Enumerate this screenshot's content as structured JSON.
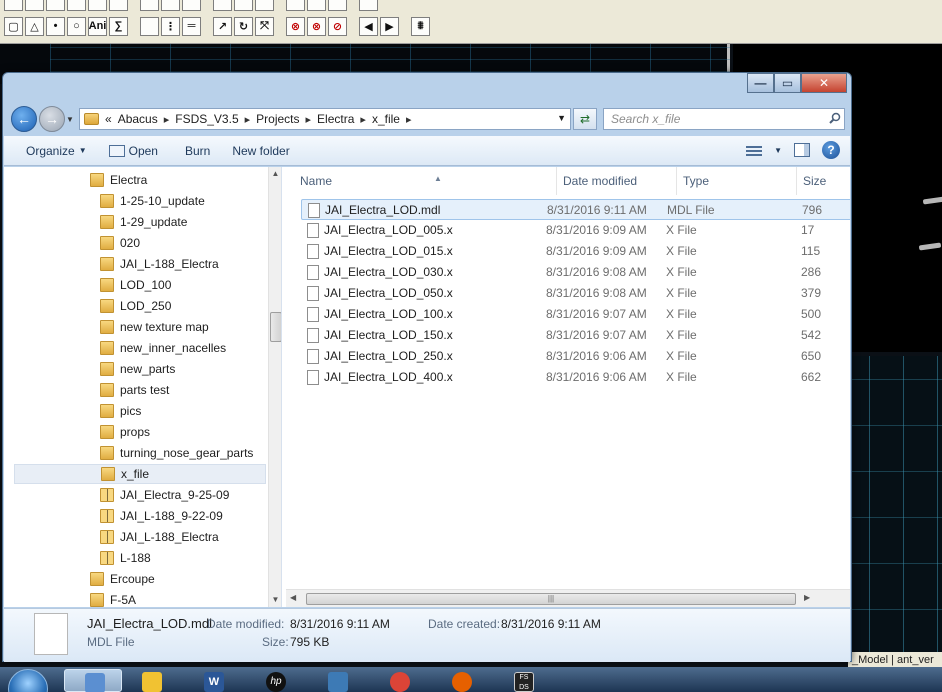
{
  "background_app": {
    "toolbar_top_row": [
      "",
      "",
      "",
      "",
      "",
      "",
      "",
      "",
      "",
      "",
      "",
      "",
      "",
      "",
      "",
      ""
    ],
    "toolbar_bottom_row": [
      "▢",
      "△",
      "•",
      "○",
      "Ani",
      "∑",
      "",
      "⋮",
      "═",
      "↗",
      "↻",
      "⤧",
      "⊗",
      "⊗",
      "⊘",
      "◀",
      "▶",
      "⩩"
    ],
    "model_tab_label": "_Model | ant_ver"
  },
  "window": {
    "controls": {
      "minimize": "—",
      "maximize": "▭",
      "close": "✕"
    },
    "back_glyph": "←",
    "forward_glyph": "→",
    "address_prefix": "«",
    "breadcrumb": [
      "Abacus",
      "FSDS_V3.5",
      "Projects",
      "Electra",
      "x_file"
    ],
    "search_placeholder": "Search x_file"
  },
  "commandbar": {
    "organize": "Organize",
    "open": "Open",
    "burn": "Burn",
    "new_folder": "New folder",
    "help": "?"
  },
  "nav_tree": [
    {
      "label": "Electra",
      "indent": 0,
      "type": "folder"
    },
    {
      "label": "1-25-10_update",
      "indent": 1,
      "type": "folder"
    },
    {
      "label": "1-29_update",
      "indent": 1,
      "type": "folder"
    },
    {
      "label": "020",
      "indent": 1,
      "type": "folder"
    },
    {
      "label": "JAI_L-188_Electra",
      "indent": 1,
      "type": "folder"
    },
    {
      "label": "LOD_100",
      "indent": 1,
      "type": "folder"
    },
    {
      "label": "LOD_250",
      "indent": 1,
      "type": "folder"
    },
    {
      "label": "new texture map",
      "indent": 1,
      "type": "folder"
    },
    {
      "label": "new_inner_nacelles",
      "indent": 1,
      "type": "folder"
    },
    {
      "label": "new_parts",
      "indent": 1,
      "type": "folder"
    },
    {
      "label": "parts test",
      "indent": 1,
      "type": "folder"
    },
    {
      "label": "pics",
      "indent": 1,
      "type": "folder"
    },
    {
      "label": "props",
      "indent": 1,
      "type": "folder"
    },
    {
      "label": "turning_nose_gear_parts",
      "indent": 1,
      "type": "folder"
    },
    {
      "label": "x_file",
      "indent": 1,
      "type": "folder",
      "selected": true
    },
    {
      "label": "JAI_Electra_9-25-09",
      "indent": 1,
      "type": "zip"
    },
    {
      "label": "JAI_L-188_9-22-09",
      "indent": 1,
      "type": "zip"
    },
    {
      "label": "JAI_L-188_Electra",
      "indent": 1,
      "type": "zip"
    },
    {
      "label": "L-188",
      "indent": 1,
      "type": "zip"
    },
    {
      "label": "Ercoupe",
      "indent": 0,
      "type": "folder"
    },
    {
      "label": "F-5A",
      "indent": 0,
      "type": "folder"
    }
  ],
  "columns": [
    "Name",
    "Date modified",
    "Type",
    "Size"
  ],
  "files": [
    {
      "name": "JAI_Electra_LOD.mdl",
      "date": "8/31/2016 9:11 AM",
      "type": "MDL File",
      "size": "796",
      "selected": true
    },
    {
      "name": "JAI_Electra_LOD_005.x",
      "date": "8/31/2016 9:09 AM",
      "type": "X File",
      "size": "17"
    },
    {
      "name": "JAI_Electra_LOD_015.x",
      "date": "8/31/2016 9:09 AM",
      "type": "X File",
      "size": "115"
    },
    {
      "name": "JAI_Electra_LOD_030.x",
      "date": "8/31/2016 9:08 AM",
      "type": "X File",
      "size": "286"
    },
    {
      "name": "JAI_Electra_LOD_050.x",
      "date": "8/31/2016 9:08 AM",
      "type": "X File",
      "size": "379"
    },
    {
      "name": "JAI_Electra_LOD_100.x",
      "date": "8/31/2016 9:07 AM",
      "type": "X File",
      "size": "500"
    },
    {
      "name": "JAI_Electra_LOD_150.x",
      "date": "8/31/2016 9:07 AM",
      "type": "X File",
      "size": "542"
    },
    {
      "name": "JAI_Electra_LOD_250.x",
      "date": "8/31/2016 9:06 AM",
      "type": "X File",
      "size": "650"
    },
    {
      "name": "JAI_Electra_LOD_400.x",
      "date": "8/31/2016 9:06 AM",
      "type": "X File",
      "size": "662"
    }
  ],
  "details": {
    "file_name": "JAI_Electra_LOD.mdl",
    "file_type": "MDL File",
    "date_modified_label": "Date modified:",
    "date_modified": "8/31/2016 9:11 AM",
    "date_created_label": "Date created:",
    "date_created": "8/31/2016 9:11 AM",
    "size_label": "Size:",
    "size": "795 KB"
  },
  "taskbar": {
    "icons": [
      "explorer-icon",
      "outlook-icon",
      "word-icon",
      "hp-icon",
      "python-icon",
      "chrome-icon",
      "firefox-icon",
      "fsds-icon"
    ],
    "hp_text": "hp",
    "word_text": "W",
    "fsds_text": "FS DS"
  },
  "colors": {
    "accent": "#1b5fb3",
    "selection": "#e5f0fb",
    "window_frame": "#b9d1ea"
  }
}
